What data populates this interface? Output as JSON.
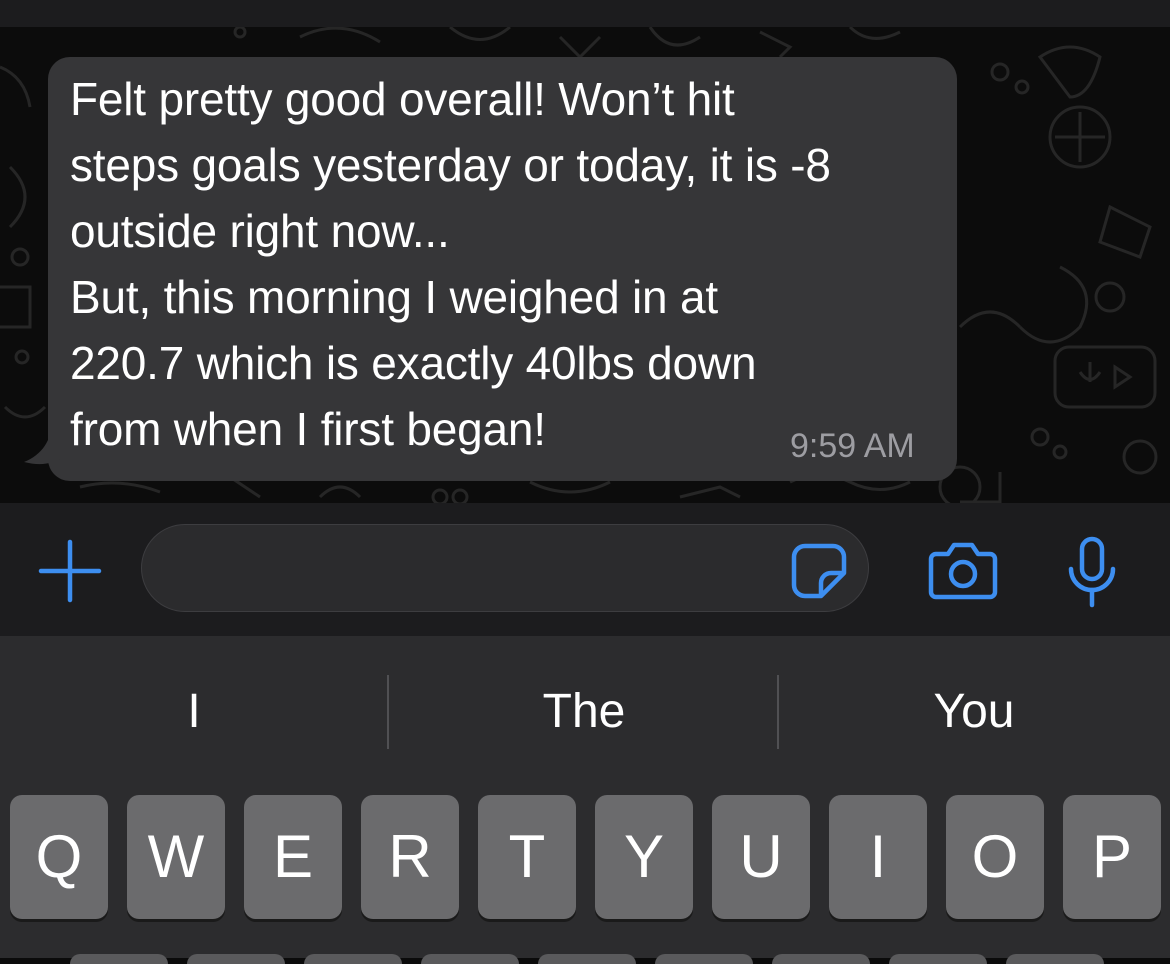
{
  "message": {
    "lines": [
      "Felt pretty good overall! Won’t hit",
      "steps goals yesterday or today, it is -8",
      "outside right now...",
      "But, this morning I weighed in at",
      "220.7 which is exactly 40lbs down",
      "from when I first began!"
    ],
    "time": "9:59 AM"
  },
  "composer": {
    "add_icon": "plus-icon",
    "sticker_icon": "sticker-icon",
    "camera_icon": "camera-icon",
    "mic_icon": "microphone-icon",
    "accent_color": "#3d8ef0"
  },
  "keyboard": {
    "suggestions": [
      "I",
      "The",
      "You"
    ],
    "keys_row1": [
      "Q",
      "W",
      "E",
      "R",
      "T",
      "Y",
      "U",
      "I",
      "O",
      "P"
    ]
  }
}
